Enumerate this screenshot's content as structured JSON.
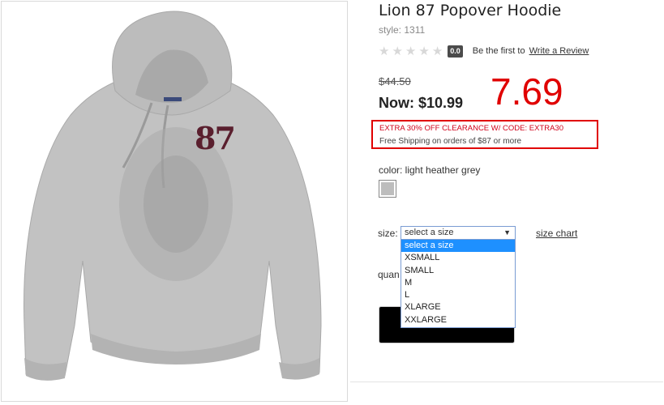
{
  "product": {
    "title": "Lion 87 Popover Hoodie",
    "style": "style: 1311",
    "graphic_number": "87"
  },
  "rating": {
    "stars": 0,
    "max_stars": 5,
    "badge": "0.0",
    "prefix": "Be the first to",
    "link": "Write a Review"
  },
  "price": {
    "old": "$44.50",
    "now": "Now: $10.99",
    "annotation": "7.69"
  },
  "promo": {
    "code_text": "EXTRA 30% OFF CLEARANCE W/ CODE: EXTRA30",
    "shipping": "Free Shipping on orders of $87 or more"
  },
  "color": {
    "label": "color: light heather grey",
    "swatch_color": "#bdbdbd"
  },
  "size": {
    "label": "size:",
    "selected": "select a size",
    "options": [
      "select a size",
      "XSMALL",
      "SMALL",
      "M",
      "L",
      "XLARGE",
      "XXLARGE"
    ],
    "chart_link": "size chart"
  },
  "quantity": {
    "label": "quan"
  },
  "colors": {
    "annotation_red": "#e00000",
    "promo_red": "#d0021b",
    "dropdown_highlight": "#1e90ff",
    "hoodie_grey": "#bdbdbd"
  }
}
